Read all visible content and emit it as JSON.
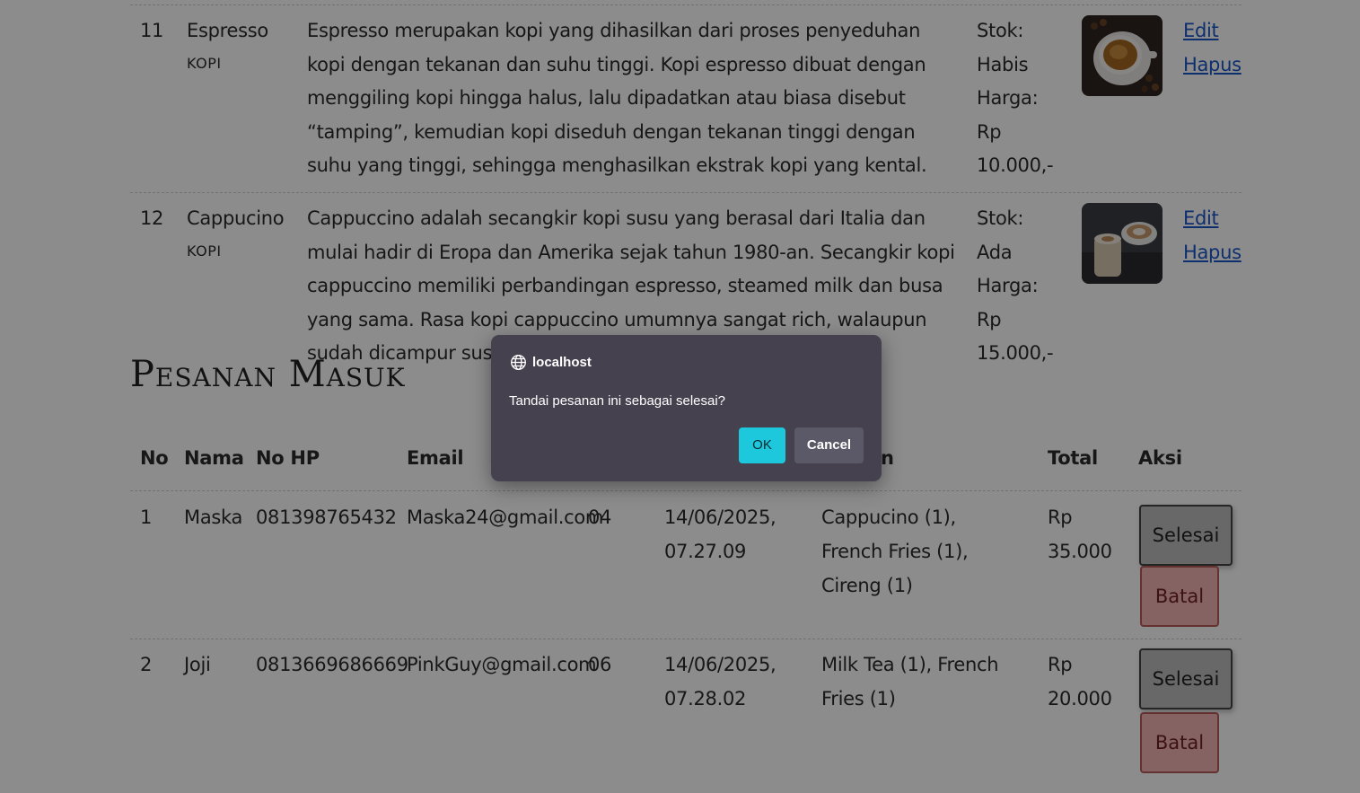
{
  "menu": {
    "rows": [
      {
        "no": "11",
        "name": "Espresso",
        "category": "KOPI",
        "description": "Espresso merupakan kopi yang dihasilkan dari proses penyeduhan kopi dengan tekanan dan suhu tinggi. Kopi espresso dibuat dengan menggiling kopi hingga halus, lalu dipadatkan atau biasa disebut “tamping”, kemudian kopi diseduh dengan tekanan tinggi dengan suhu yang tinggi, sehingga menghasilkan ekstrak kopi yang kental.",
        "stock": "Stok: Habis",
        "price": "Harga: Rp 10.000,-",
        "edit": "Edit",
        "delete": "Hapus"
      },
      {
        "no": "12",
        "name": "Cappucino",
        "category": "KOPI",
        "description": "Cappuccino adalah secangkir kopi susu yang berasal dari Italia dan mulai hadir di Eropa dan Amerika sejak tahun 1980-an. Secangkir kopi cappuccino memiliki perbandingan espresso, steamed milk dan busa yang sama. Rasa kopi cappuccino umumnya sangat rich, walaupun sudah dicampur susu, rasa kopinya tetap kuat.",
        "stock": "Stok: Ada",
        "price": "Harga: Rp 15.000,-",
        "edit": "Edit",
        "delete": "Hapus"
      }
    ]
  },
  "orders": {
    "title": "Pesanan Masuk",
    "headers": [
      "No",
      "Nama",
      "No HP",
      "Email",
      "",
      "",
      "n",
      "Total",
      "Aksi"
    ],
    "rows": [
      {
        "no": "1",
        "name": "Maska",
        "phone": "081398765432",
        "email": "Maska24@gmail.com",
        "table": "04",
        "time": "14/06/2025, 07.27.09",
        "items": "Cappucino (1), French Fries (1), Cireng (1)",
        "total": "Rp 35.000",
        "done": "Selesai",
        "cancel": "Batal"
      },
      {
        "no": "2",
        "name": "Joji",
        "phone": "0813669686669",
        "email": "PinkGuy@gmail.com",
        "table": "06",
        "time": "14/06/2025, 07.28.02",
        "items": "Milk Tea (1), French Fries (1)",
        "total": "Rp 20.000",
        "done": "Selesai",
        "cancel": "Batal"
      }
    ]
  },
  "dialog": {
    "origin": "localhost",
    "message": "Tandai pesanan ini sebagai selesai?",
    "ok": "OK",
    "cancel": "Cancel"
  },
  "colors": {
    "dialog_bg": "#45414f",
    "ok_button": "#1ec8dc",
    "link": "#1a57c8",
    "done_button": "#bdbdbd",
    "cancel_button": "#f3b5b5"
  }
}
